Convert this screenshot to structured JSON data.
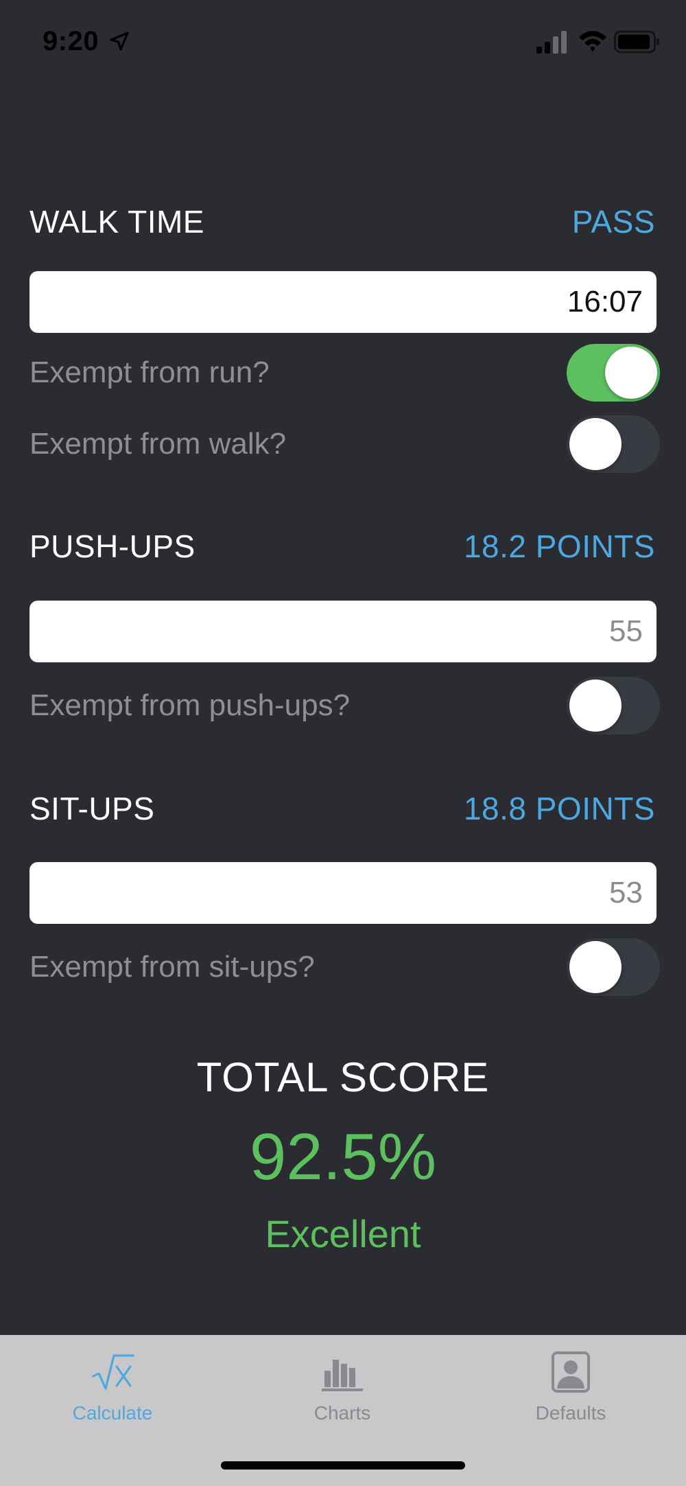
{
  "status_bar": {
    "time": "9:20",
    "icons": [
      "location-arrow-icon",
      "cellular-signal-icon",
      "wifi-icon",
      "battery-icon"
    ]
  },
  "sections": {
    "walk": {
      "title": "WALK TIME",
      "result": "PASS",
      "input_value": "16:07",
      "exempt_run_label": "Exempt from run?",
      "exempt_run_on": true,
      "exempt_walk_label": "Exempt from walk?",
      "exempt_walk_on": false
    },
    "pushups": {
      "title": "PUSH-UPS",
      "result": "18.2 POINTS",
      "input_placeholder": "55",
      "exempt_label": "Exempt from push-ups?",
      "exempt_on": false
    },
    "situps": {
      "title": "SIT-UPS",
      "result": "18.8 POINTS",
      "input_placeholder": "53",
      "exempt_label": "Exempt from sit-ups?",
      "exempt_on": false
    }
  },
  "total": {
    "title": "TOTAL SCORE",
    "value": "92.5%",
    "rating": "Excellent"
  },
  "tabbar": {
    "tabs": [
      {
        "label": "Calculate",
        "icon": "square-root-icon",
        "active": true
      },
      {
        "label": "Charts",
        "icon": "bar-chart-icon",
        "active": false
      },
      {
        "label": "Defaults",
        "icon": "person-portrait-icon",
        "active": false
      }
    ]
  },
  "colors": {
    "background": "#2a2c32",
    "accent_blue": "#4ea8e0",
    "success_green": "#5cc05f",
    "tabbar_bg": "#c8c8cb"
  }
}
